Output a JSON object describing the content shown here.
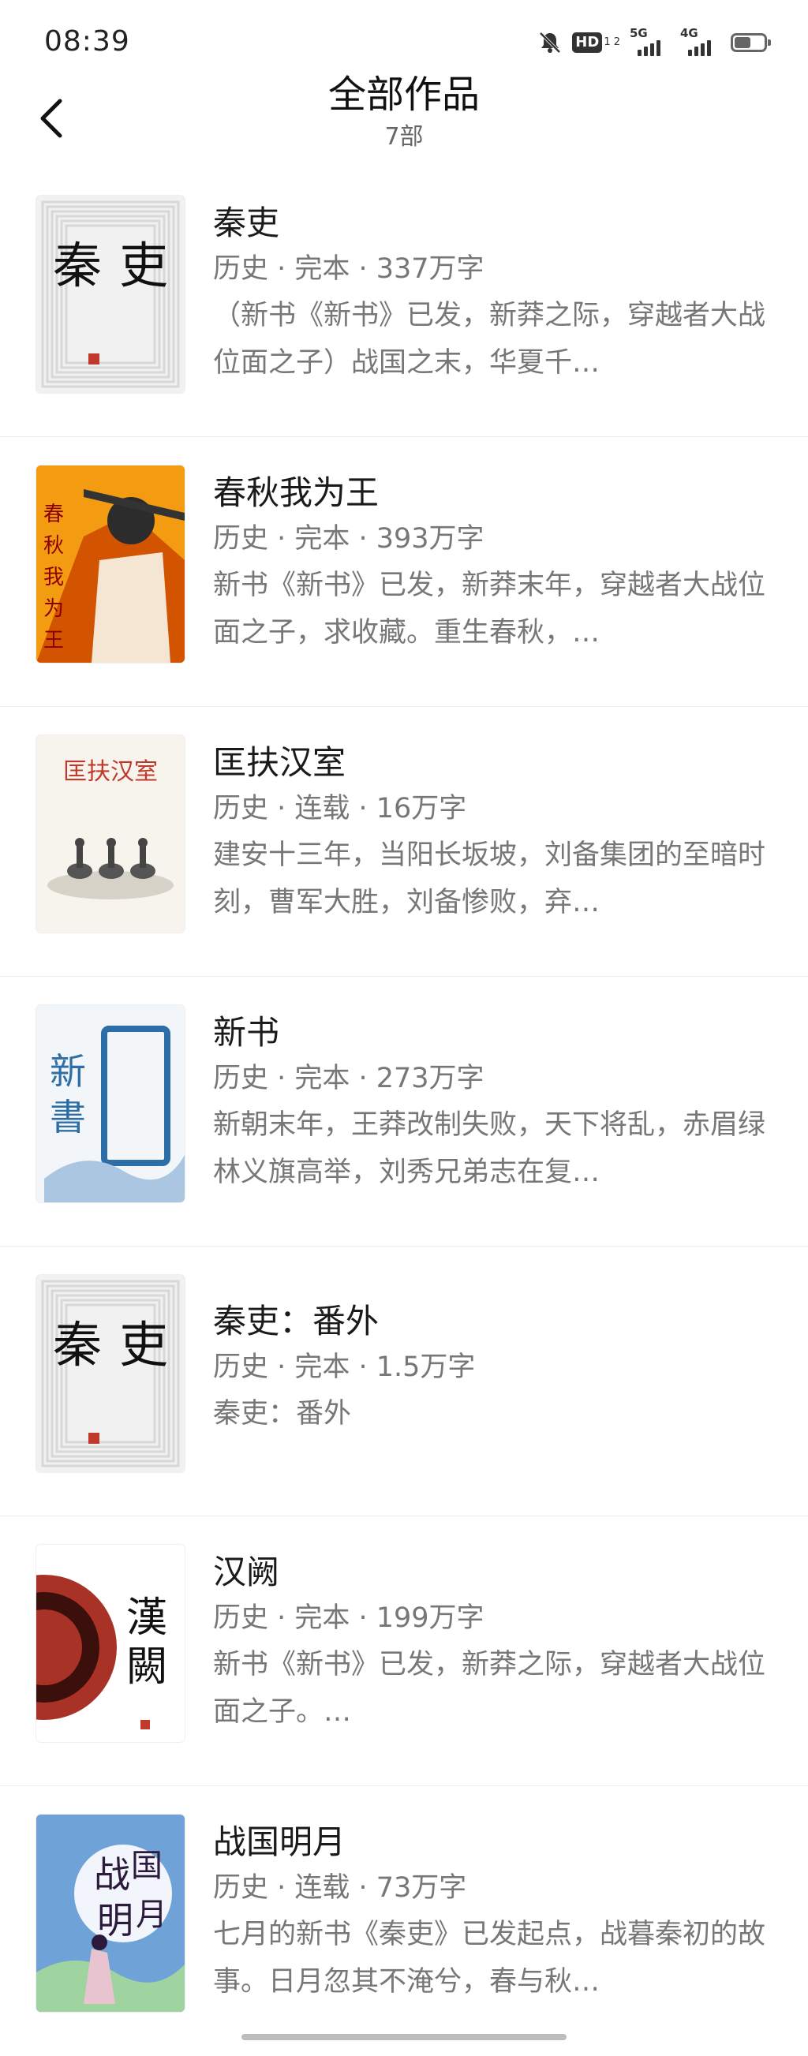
{
  "status": {
    "time": "08:39",
    "icons": [
      "bell-off-icon",
      "hd-icon",
      "5g-signal-icon",
      "4g-signal-icon",
      "battery-icon"
    ],
    "hd_label": "HD",
    "hd_sub": "1 2",
    "net1_label": "5G",
    "net2_label": "4G",
    "battery_level": 0.55
  },
  "header": {
    "title": "全部作品",
    "subtitle": "7部",
    "back_icon": "chevron-left-icon"
  },
  "books": [
    {
      "title": "秦吏",
      "meta": "历史 · 完本 · 337万字",
      "description": "（新书《新书》已发，新莽之际，穿越者大战位面之子）战国之末，华夏千…",
      "cover": {
        "style": "seal",
        "text": "秦吏",
        "bg": "#f1f1f1",
        "accent": "#c0392b"
      }
    },
    {
      "title": "春秋我为王",
      "meta": "历史 · 完本 · 393万字",
      "description": "新书《新书》已发，新莽末年，穿越者大战位面之子，求收藏。重生春秋，…",
      "cover": {
        "style": "warrior",
        "text": "春秋我为王",
        "bg": "#d35400",
        "accent": "#f1c40f"
      }
    },
    {
      "title": "匡扶汉室",
      "meta": "历史 · 连载 · 16万字",
      "description": "建安十三年，当阳长坂坡，刘备集团的至暗时刻，曹军大胜，刘备惨败，弃…",
      "cover": {
        "style": "ink",
        "text": "匡扶汉室",
        "bg": "#f7f4ee",
        "accent": "#c0392b"
      }
    },
    {
      "title": "新书",
      "meta": "历史 · 完本 · 273万字",
      "description": "新朝末年，王莽改制失败，天下将乱，赤眉绿林义旗高举，刘秀兄弟志在复…",
      "cover": {
        "style": "blue",
        "text": "新書",
        "bg": "#f3f6f8",
        "accent": "#2e6ea6"
      }
    },
    {
      "title": "秦吏：番外",
      "meta": "历史 · 完本 · 1.5万字",
      "description": "秦吏：番外",
      "cover": {
        "style": "seal",
        "text": "秦吏",
        "bg": "#f1f1f1",
        "accent": "#c0392b"
      }
    },
    {
      "title": "汉阙",
      "meta": "历史 · 完本 · 199万字",
      "description": "新书《新书》已发，新莽之际，穿越者大战位面之子。…",
      "cover": {
        "style": "disc",
        "text": "漢闕",
        "bg": "#ffffff",
        "accent": "#a93226"
      }
    },
    {
      "title": "战国明月",
      "meta": "历史 · 连载 · 73万字",
      "description": "七月的新书《秦吏》已发起点，战暮秦初的故事。日月忽其不淹兮，春与秋…",
      "cover": {
        "style": "moon",
        "text": "战国明月",
        "bg": "#6fa3d8",
        "accent": "#2c1a3d"
      }
    }
  ]
}
